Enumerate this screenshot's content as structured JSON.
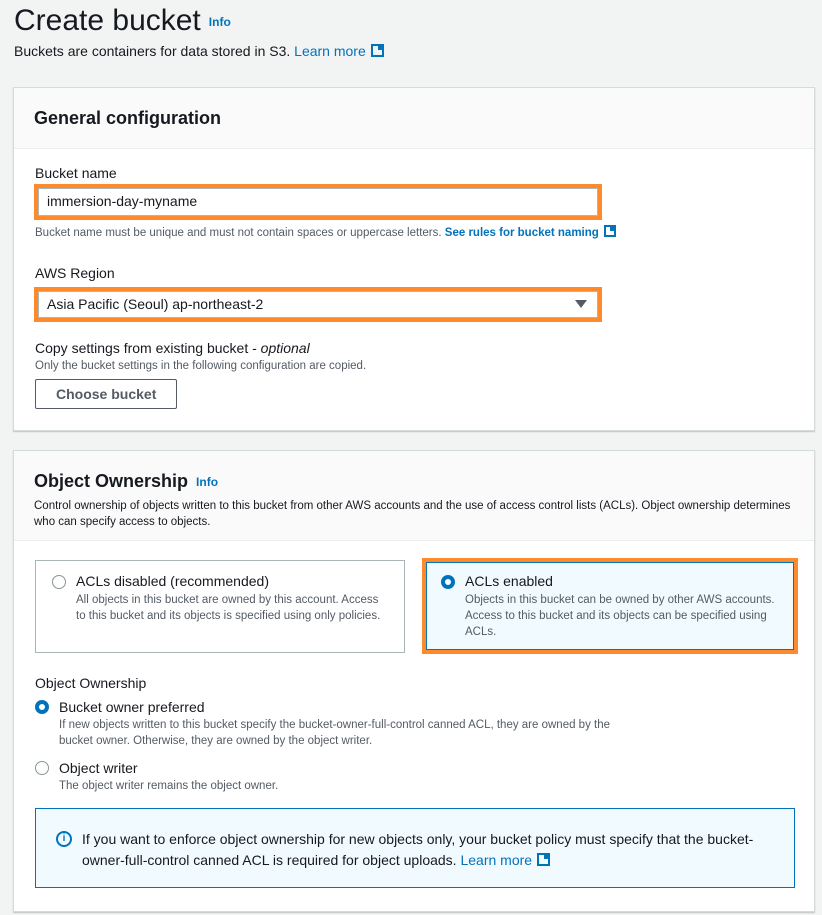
{
  "header": {
    "title": "Create bucket",
    "info": "Info",
    "subtitle": "Buckets are containers for data stored in S3.",
    "learn_more": "Learn more"
  },
  "general": {
    "title": "General configuration",
    "bucket_name_label": "Bucket name",
    "bucket_name_value": "immersion-day-myname",
    "bucket_name_hint": "Bucket name must be unique and must not contain spaces or uppercase letters.",
    "bucket_name_rules": "See rules for bucket naming",
    "region_label": "AWS Region",
    "region_value": "Asia Pacific (Seoul) ap-northeast-2",
    "copy_label": "Copy settings from existing bucket - ",
    "copy_optional": "optional",
    "copy_hint": "Only the bucket settings in the following configuration are copied.",
    "choose_bucket": "Choose bucket"
  },
  "ownership": {
    "title": "Object Ownership",
    "info": "Info",
    "desc": "Control ownership of objects written to this bucket from other AWS accounts and the use of access control lists (ACLs). Object ownership determines who can specify access to objects.",
    "acl_options": [
      {
        "title": "ACLs disabled (recommended)",
        "desc": "All objects in this bucket are owned by this account. Access to this bucket and its objects is specified using only policies.",
        "selected": false
      },
      {
        "title": "ACLs enabled",
        "desc": "Objects in this bucket can be owned by other AWS accounts. Access to this bucket and its objects can be specified using ACLs.",
        "selected": true
      }
    ],
    "owner_label": "Object Ownership",
    "owner_options": [
      {
        "title": "Bucket owner preferred",
        "desc": "If new objects written to this bucket specify the bucket-owner-full-control canned ACL, they are owned by the bucket owner. Otherwise, they are owned by the object writer.",
        "selected": true
      },
      {
        "title": "Object writer",
        "desc": "The object writer remains the object owner.",
        "selected": false
      }
    ],
    "alert_text": "If you want to enforce object ownership for new objects only, your bucket policy must specify that the bucket-owner-full-control canned ACL is required for object uploads.",
    "alert_link": "Learn more"
  },
  "colors": {
    "accent": "#0073bb",
    "highlight": "#ff8a2b"
  }
}
